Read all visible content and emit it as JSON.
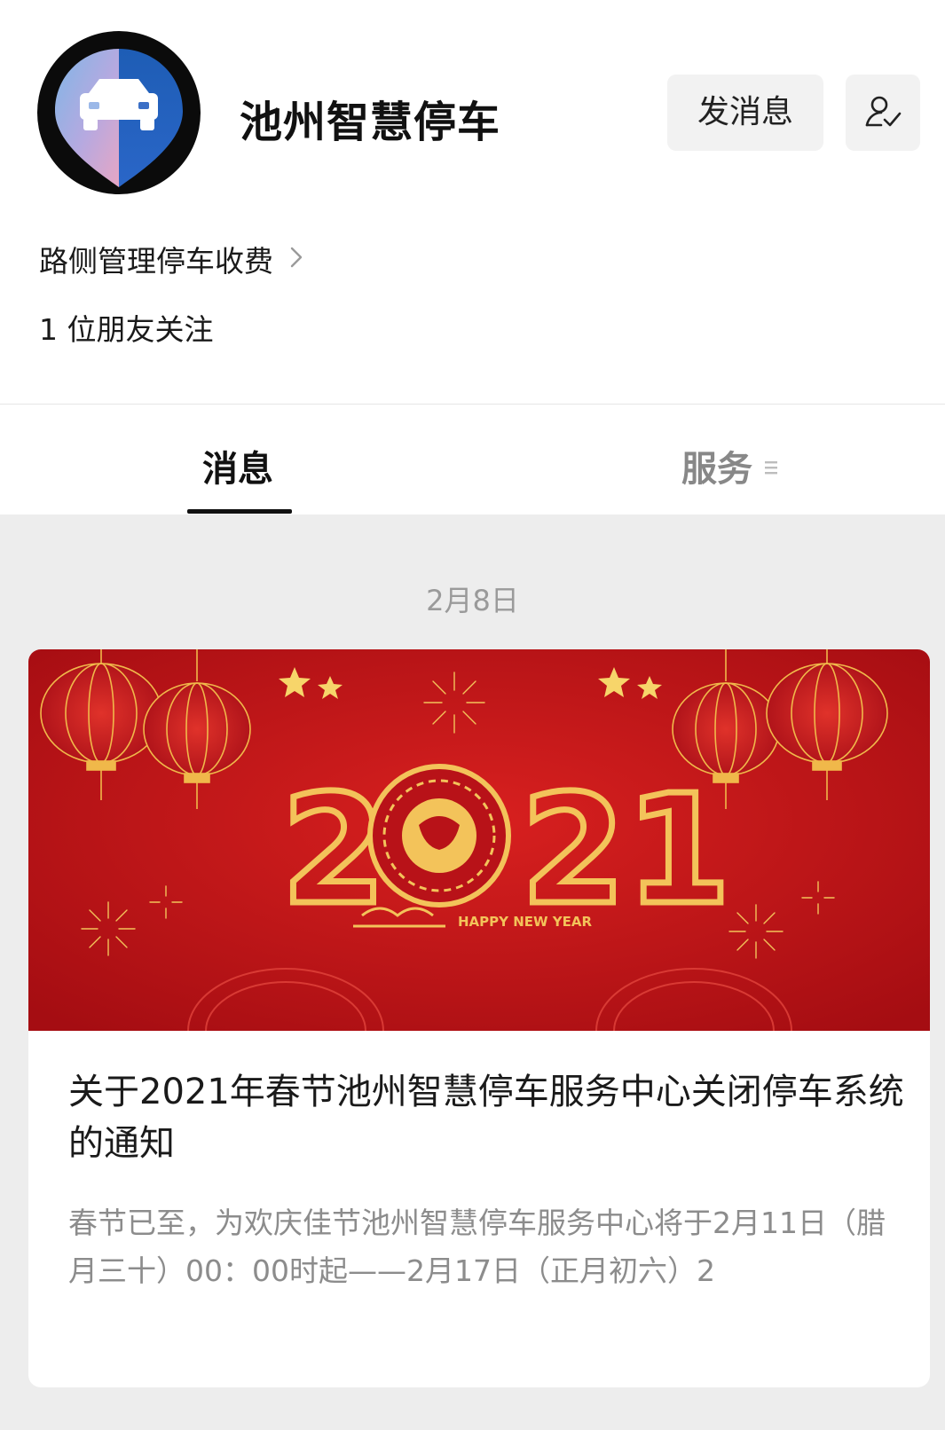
{
  "account": {
    "name": "池州智慧停车",
    "description": "路侧管理停车收费",
    "friends_following": "1 位朋友关注",
    "avatar_icon": "car-icon"
  },
  "actions": {
    "send_message_label": "发消息",
    "follow_icon": "user-check-icon"
  },
  "tabs": [
    {
      "label": "消息",
      "active": true
    },
    {
      "label": "服务",
      "active": false,
      "icon": "menu-icon"
    }
  ],
  "feed": {
    "date": "2月8日",
    "article": {
      "banner": {
        "year": "2021",
        "caption": "HAPPY NEW YEAR",
        "colors": {
          "background": "#c4121a",
          "gold": "#f3c35a"
        }
      },
      "title": "关于2021年春节池州智慧停车服务中心关闭停车系统的通知",
      "digest": "春节已至，为欢庆佳节池州智慧停车服务中心将于2月11日（腊月三十）00：00时起——2月17日（正月初六）2"
    }
  }
}
